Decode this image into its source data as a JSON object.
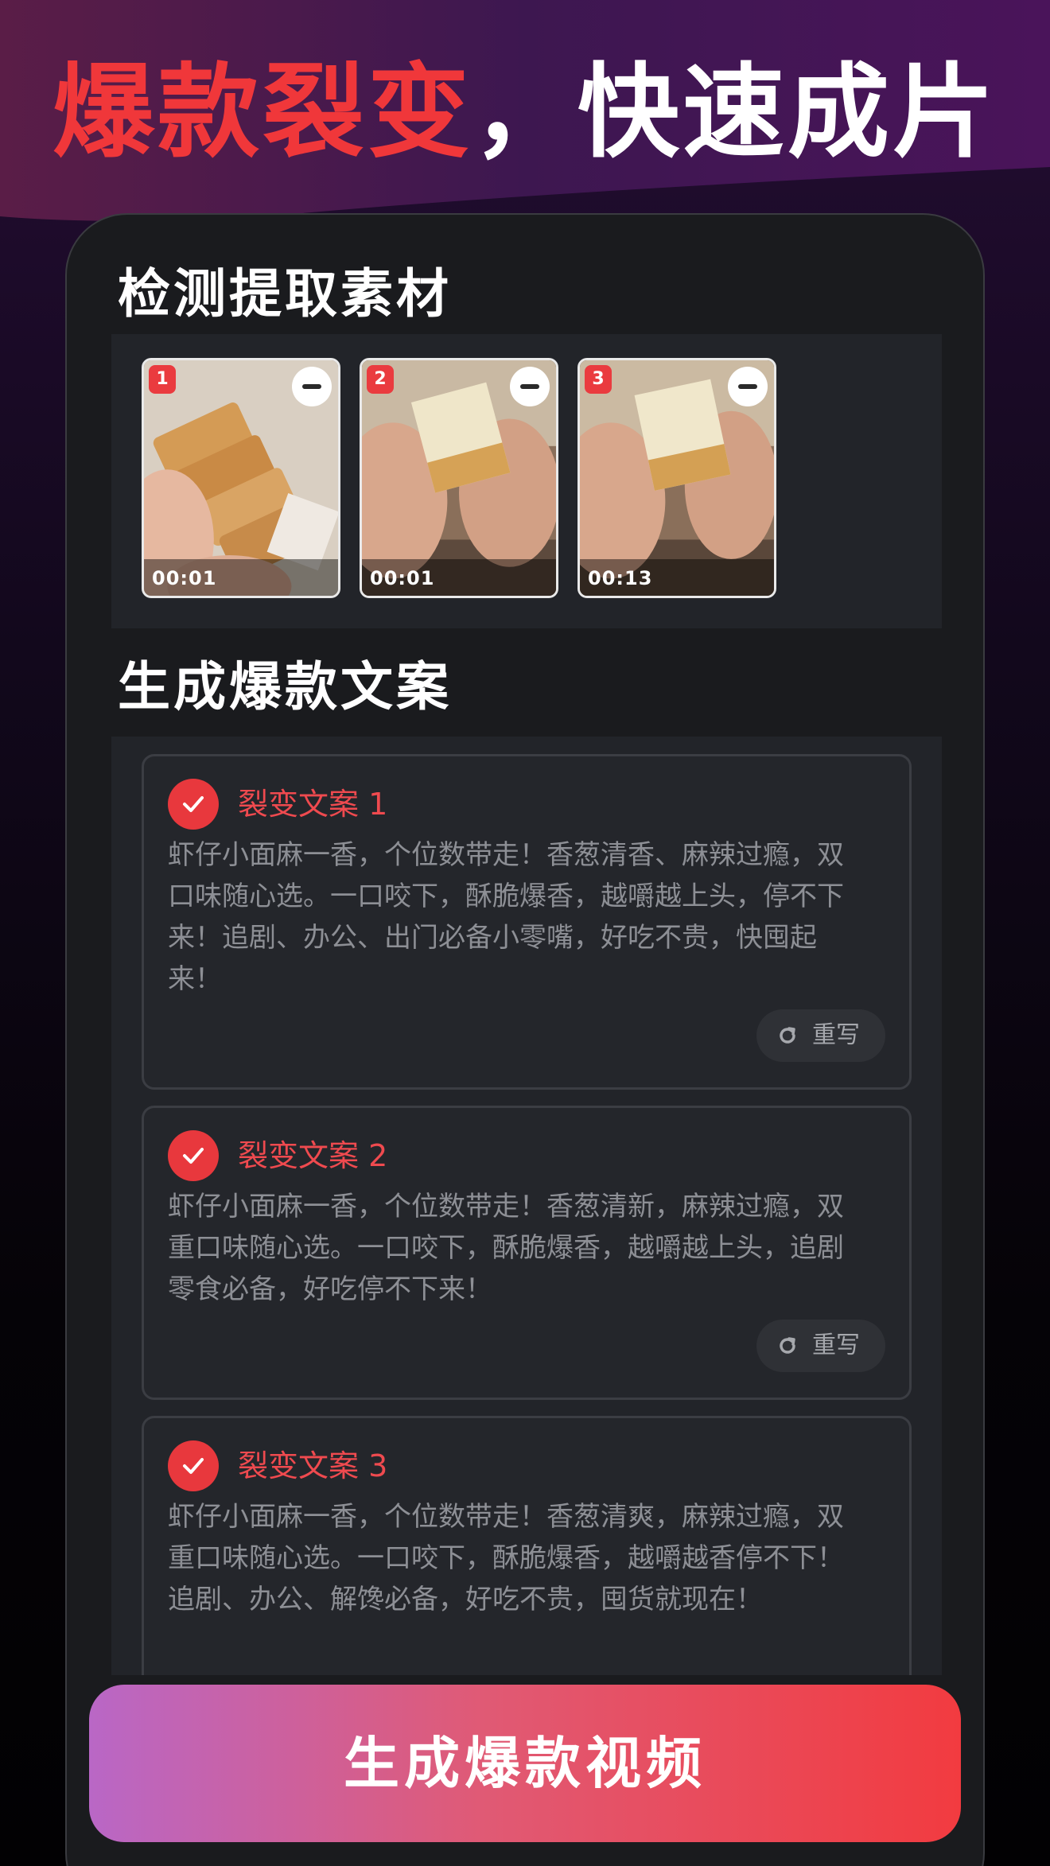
{
  "hero": {
    "title_highlight": "爆款裂变",
    "title_rest": "，快速成片"
  },
  "materials": {
    "title": "检测提取素材",
    "items": [
      {
        "index": "1",
        "duration": "00:01"
      },
      {
        "index": "2",
        "duration": "00:01"
      },
      {
        "index": "3",
        "duration": "00:13"
      }
    ]
  },
  "copywriting": {
    "title": "生成爆款文案",
    "items": [
      {
        "label": "裂变文案 1",
        "text": "虾仔小面麻一香，个位数带走！香葱清香、麻辣过瘾，双口味随心选。一口咬下，酥脆爆香，越嚼越上头，停不下来！追剧、办公、出门必备小零嘴，好吃不贵，快囤起来！",
        "rewrite": "重写"
      },
      {
        "label": "裂变文案 2",
        "text": "虾仔小面麻一香，个位数带走！香葱清新，麻辣过瘾，双重口味随心选。一口咬下，酥脆爆香，越嚼越上头，追剧零食必备，好吃停不下来！",
        "rewrite": "重写"
      },
      {
        "label": "裂变文案 3",
        "text": "虾仔小面麻一香，个位数带走！香葱清爽，麻辣过瘾，双重口味随心选。一口咬下，酥脆爆香，越嚼越香停不下！追剧、办公、解馋必备，好吃不贵，囤货就现在！"
      }
    ]
  },
  "actions": {
    "generate_label": "生成爆款视频"
  },
  "colors": {
    "accent_red": "#ef4a4f",
    "button_gradient_start": "#b967c6",
    "button_gradient_end": "#f23b40"
  }
}
